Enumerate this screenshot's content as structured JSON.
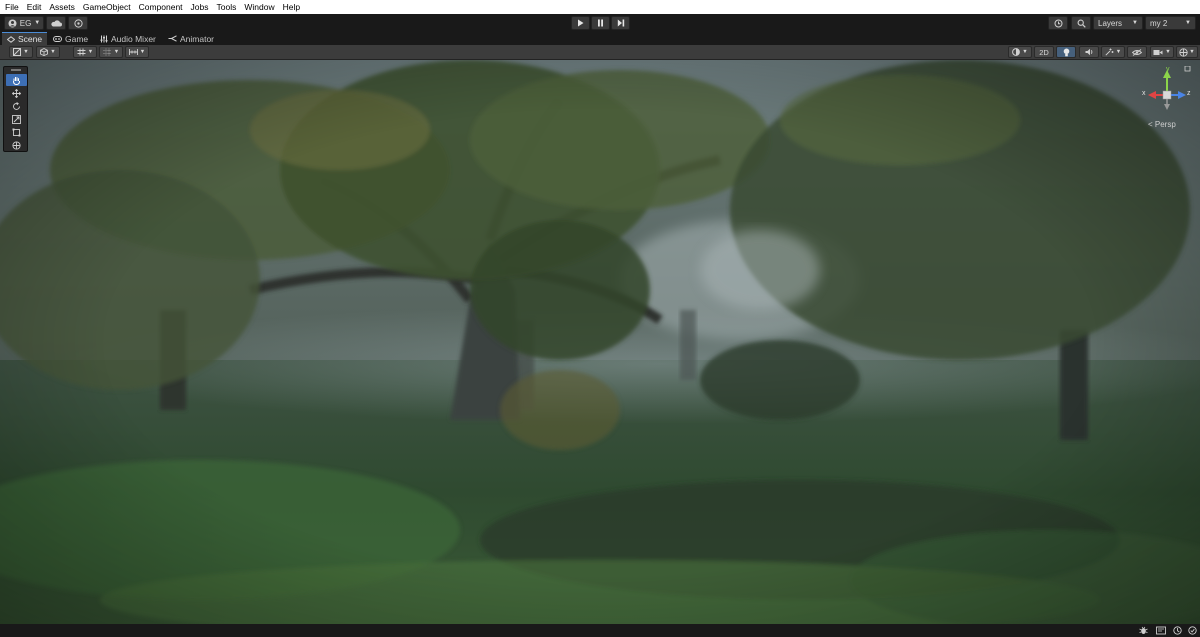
{
  "menu": [
    "File",
    "Edit",
    "Assets",
    "GameObject",
    "Component",
    "Jobs",
    "Tools",
    "Window",
    "Help"
  ],
  "toolbar": {
    "account_label": "EG",
    "layers_label": "Layers",
    "layout_label": "my 2"
  },
  "tabs": [
    {
      "label": "Scene",
      "icon": "scene-icon"
    },
    {
      "label": "Game",
      "icon": "game-icon"
    },
    {
      "label": "Audio Mixer",
      "icon": "audio-mixer-icon"
    },
    {
      "label": "Animator",
      "icon": "animator-icon"
    }
  ],
  "scene_toolbar": {
    "mode_2d_label": "2D"
  },
  "tools": [
    "hand-tool-icon",
    "move-tool-icon",
    "rotate-tool-icon",
    "scale-tool-icon",
    "rect-tool-icon",
    "transform-tool-icon"
  ],
  "gizmo": {
    "x_label": "x",
    "y_label": "y",
    "z_label": "z",
    "projection_label": "< Persp"
  },
  "colors": {
    "accent": "#3d6fb5",
    "tab_highlight": "#4b8cd6",
    "gizmo_x": "#e04444",
    "gizmo_y": "#8cd44a",
    "gizmo_z": "#4a84e6"
  }
}
